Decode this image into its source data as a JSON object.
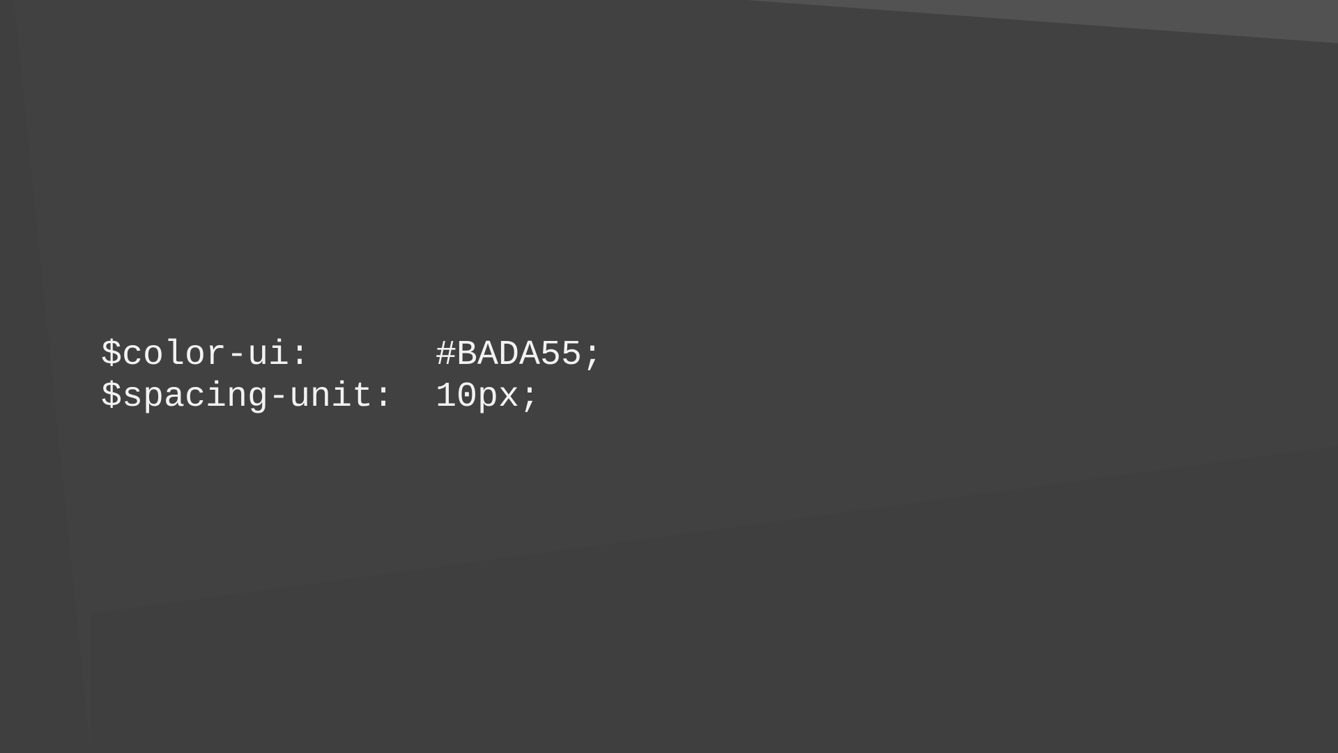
{
  "background": {
    "base_color": "#414141",
    "highlight_color": "#525252",
    "shade_color": "#3c3c3c"
  },
  "code": {
    "text_color": "#f2f2f2",
    "lines": [
      {
        "name": "$color-ui:",
        "value": "#BADA55;"
      },
      {
        "name": "$spacing-unit:",
        "value": "10px;"
      }
    ]
  }
}
